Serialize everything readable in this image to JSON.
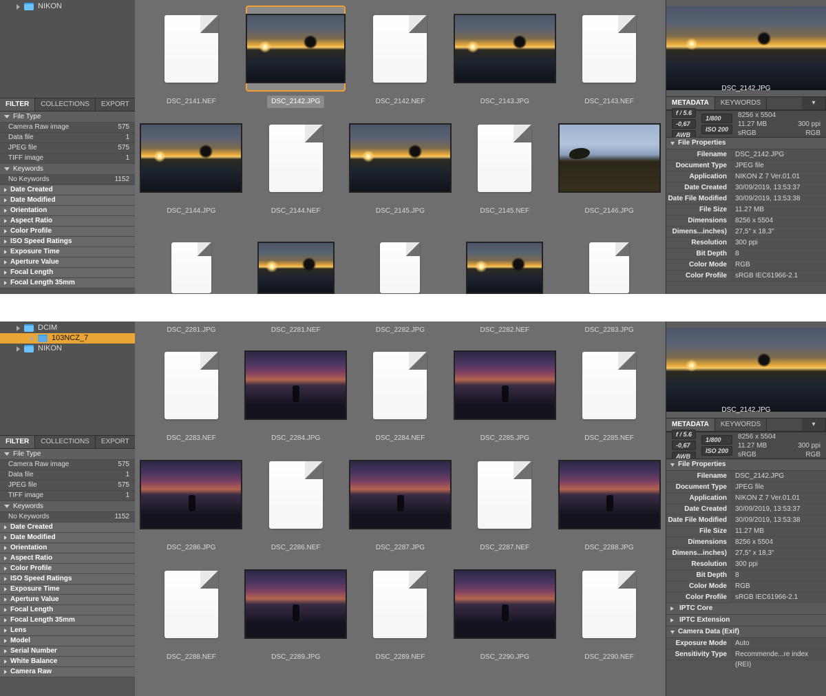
{
  "top": {
    "tree": [
      {
        "label": "NIKON",
        "indent": 0,
        "sel": false
      }
    ],
    "leftTabs": {
      "active": "FILTER",
      "tabs": [
        "FILTER",
        "COLLECTIONS",
        "EXPORT"
      ]
    },
    "filter": {
      "fileTypeHeader": "File Type",
      "fileTypes": [
        {
          "k": "Camera Raw image",
          "v": "575"
        },
        {
          "k": "Data file",
          "v": "1"
        },
        {
          "k": "JPEG file",
          "v": "575"
        },
        {
          "k": "TIFF image",
          "v": "1"
        }
      ],
      "keywordsHeader": "Keywords",
      "keywords": [
        {
          "k": "No Keywords",
          "v": "1152"
        }
      ],
      "cats": [
        "Date Created",
        "Date Modified",
        "Orientation",
        "Aspect Ratio",
        "Color Profile",
        "ISO Speed Ratings",
        "Exposure Time",
        "Aperture Value",
        "Focal Length",
        "Focal Length 35mm"
      ]
    },
    "grid": [
      {
        "label": "DSC_2141.NEF",
        "kind": "nef"
      },
      {
        "label": "DSC_2142.JPG",
        "kind": "sunset",
        "selected": true
      },
      {
        "label": "DSC_2142.NEF",
        "kind": "nef"
      },
      {
        "label": "DSC_2143.JPG",
        "kind": "sunset"
      },
      {
        "label": "DSC_2143.NEF",
        "kind": "nef"
      },
      {
        "label": "DSC_2144.JPG",
        "kind": "sunset"
      },
      {
        "label": "DSC_2144.NEF",
        "kind": "nef"
      },
      {
        "label": "DSC_2145.JPG",
        "kind": "sunset"
      },
      {
        "label": "DSC_2145.NEF",
        "kind": "nef"
      },
      {
        "label": "DSC_2146.JPG",
        "kind": "shore"
      },
      {
        "label": "",
        "kind": "nef-small"
      },
      {
        "label": "",
        "kind": "sunset-trim"
      },
      {
        "label": "",
        "kind": "nef-small"
      },
      {
        "label": "",
        "kind": "sunset-trim"
      },
      {
        "label": "",
        "kind": "nef-small"
      }
    ],
    "preview": {
      "label": "DSC_2142.JPG",
      "kind": "sunset"
    },
    "rightTabs": {
      "active": "METADATA",
      "tabs": [
        "METADATA",
        "KEYWORDS"
      ]
    },
    "badges": {
      "aperture": "f / 5.6",
      "shutter": "1/800",
      "ev": "-0,67",
      "wb": "AWB",
      "iso": "ISO 200",
      "dim": "8256 x 5504",
      "size": "11.27 MB",
      "ppi": "300 ppi",
      "space": "sRGB",
      "mode": "RGB"
    },
    "props": {
      "header": "File Properties",
      "rows": [
        {
          "k": "Filename",
          "v": "DSC_2142.JPG"
        },
        {
          "k": "Document Type",
          "v": "JPEG file"
        },
        {
          "k": "Application",
          "v": "NIKON Z 7 Ver.01.01"
        },
        {
          "k": "Date Created",
          "v": "30/09/2019, 13:53:37"
        },
        {
          "k": "Date File Modified",
          "v": "30/09/2019, 13:53:38"
        },
        {
          "k": "File Size",
          "v": "11.27 MB"
        },
        {
          "k": "Dimensions",
          "v": "8256 x 5504"
        },
        {
          "k": "Dimens...inches)",
          "v": "27,5\" x 18,3\""
        },
        {
          "k": "Resolution",
          "v": "300 ppi"
        },
        {
          "k": "Bit Depth",
          "v": "8"
        },
        {
          "k": "Color Mode",
          "v": "RGB"
        },
        {
          "k": "Color Profile",
          "v": "sRGB IEC61966-2.1"
        }
      ]
    }
  },
  "bottom": {
    "tree": [
      {
        "label": "DCIM",
        "indent": 0,
        "sel": false
      },
      {
        "label": "103NCZ_7",
        "indent": 1,
        "sel": true
      },
      {
        "label": "NIKON",
        "indent": 0,
        "sel": false
      }
    ],
    "gridHeader": [
      "DSC_2281.JPG",
      "DSC_2281.NEF",
      "DSC_2282.JPG",
      "DSC_2282.NEF",
      "DSC_2283.JPG"
    ],
    "grid": [
      {
        "label": "DSC_2283.NEF",
        "kind": "nef"
      },
      {
        "label": "DSC_2284.JPG",
        "kind": "purple"
      },
      {
        "label": "DSC_2284.NEF",
        "kind": "nef"
      },
      {
        "label": "DSC_2285.JPG",
        "kind": "purple"
      },
      {
        "label": "DSC_2285.NEF",
        "kind": "nef"
      },
      {
        "label": "DSC_2286.JPG",
        "kind": "purple"
      },
      {
        "label": "DSC_2286.NEF",
        "kind": "nef"
      },
      {
        "label": "DSC_2287.JPG",
        "kind": "purple"
      },
      {
        "label": "DSC_2287.NEF",
        "kind": "nef"
      },
      {
        "label": "DSC_2288.JPG",
        "kind": "purple"
      },
      {
        "label": "DSC_2288.NEF",
        "kind": "nef"
      },
      {
        "label": "DSC_2289.JPG",
        "kind": "purple"
      },
      {
        "label": "DSC_2289.NEF",
        "kind": "nef"
      },
      {
        "label": "DSC_2290.JPG",
        "kind": "purple"
      },
      {
        "label": "DSC_2290.NEF",
        "kind": "nef"
      }
    ],
    "leftTabs": {
      "active": "FILTER",
      "tabs": [
        "FILTER",
        "COLLECTIONS",
        "EXPORT"
      ]
    },
    "filter": {
      "fileTypeHeader": "File Type",
      "fileTypes": [
        {
          "k": "Camera Raw image",
          "v": "575"
        },
        {
          "k": "Data file",
          "v": "1"
        },
        {
          "k": "JPEG file",
          "v": "575"
        },
        {
          "k": "TIFF image",
          "v": "1"
        }
      ],
      "keywordsHeader": "Keywords",
      "keywords": [
        {
          "k": "No Keywords",
          "v": "1152"
        }
      ],
      "cats": [
        "Date Created",
        "Date Modified",
        "Orientation",
        "Aspect Ratio",
        "Color Profile",
        "ISO Speed Ratings",
        "Exposure Time",
        "Aperture Value",
        "Focal Length",
        "Focal Length 35mm",
        "Lens",
        "Model",
        "Serial Number",
        "White Balance",
        "Camera Raw"
      ]
    },
    "preview": {
      "label": "DSC_2142.JPG",
      "kind": "sunset"
    },
    "rightTabs": {
      "active": "METADATA",
      "tabs": [
        "METADATA",
        "KEYWORDS"
      ]
    },
    "badges": {
      "aperture": "f / 5.6",
      "shutter": "1/800",
      "ev": "-0,67",
      "wb": "AWB",
      "iso": "ISO 200",
      "dim": "8256 x 5504",
      "size": "11.27 MB",
      "ppi": "300 ppi",
      "space": "sRGB",
      "mode": "RGB"
    },
    "props": {
      "header": "File Properties",
      "rows": [
        {
          "k": "Filename",
          "v": "DSC_2142.JPG"
        },
        {
          "k": "Document Type",
          "v": "JPEG file"
        },
        {
          "k": "Application",
          "v": "NIKON Z 7 Ver.01.01"
        },
        {
          "k": "Date Created",
          "v": "30/09/2019, 13:53:37"
        },
        {
          "k": "Date File Modified",
          "v": "30/09/2019, 13:53:38"
        },
        {
          "k": "File Size",
          "v": "11.27 MB"
        },
        {
          "k": "Dimensions",
          "v": "8256 x 5504"
        },
        {
          "k": "Dimens...inches)",
          "v": "27,5\" x 18,3\""
        },
        {
          "k": "Resolution",
          "v": "300 ppi"
        },
        {
          "k": "Bit Depth",
          "v": "8"
        },
        {
          "k": "Color Mode",
          "v": "RGB"
        },
        {
          "k": "Color Profile",
          "v": "sRGB IEC61966-2.1"
        }
      ]
    },
    "extraSections": [
      "IPTC Core",
      "IPTC Extension"
    ],
    "exif": {
      "header": "Camera Data (Exif)",
      "rows": [
        {
          "k": "Exposure Mode",
          "v": "Auto"
        },
        {
          "k": "Sensitivity Type",
          "v": "Recommende...re index (REI)"
        }
      ]
    }
  }
}
